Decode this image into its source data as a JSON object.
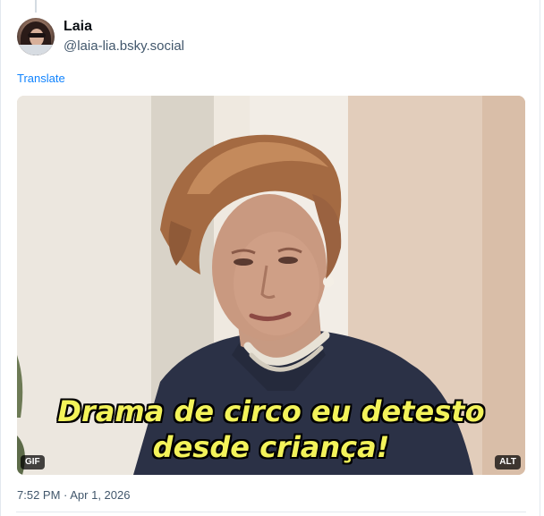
{
  "post": {
    "author": {
      "display_name": "Laia",
      "handle": "@laia-lia.bsky.social"
    },
    "translate_label": "Translate",
    "media": {
      "caption_line1": "Drama de circo eu detesto",
      "caption_line2": "desde criança!",
      "gif_badge": "GIF",
      "alt_badge": "ALT"
    },
    "timestamp": "7:52 PM · Apr 1, 2026"
  },
  "colors": {
    "link": "#1083fe",
    "muted": "#42576c",
    "caption": "#f3f35a"
  }
}
